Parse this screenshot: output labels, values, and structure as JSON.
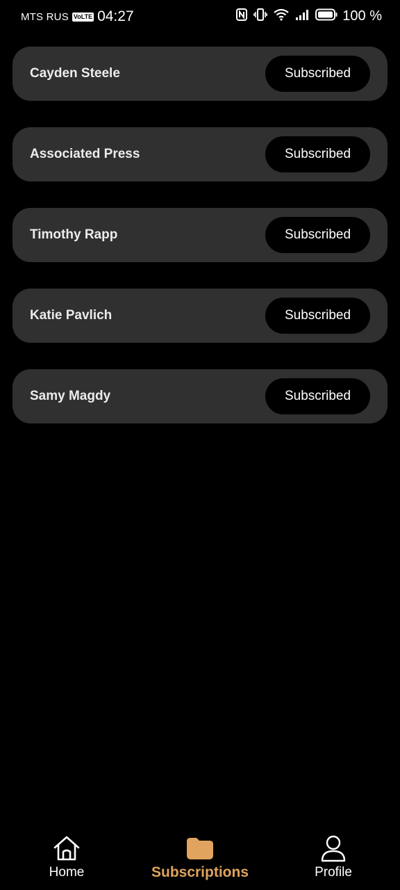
{
  "status_bar": {
    "carrier": "MTS RUS",
    "volte": "VoLTE",
    "time": "04:27",
    "battery_percent": "100 %",
    "icons": [
      "nfc-icon",
      "vibrate-icon",
      "wifi-icon",
      "signal-icon",
      "battery-icon"
    ]
  },
  "subscriptions": [
    {
      "name": "Cayden Steele",
      "button_label": "Subscribed"
    },
    {
      "name": "Associated Press",
      "button_label": "Subscribed"
    },
    {
      "name": "Timothy Rapp",
      "button_label": "Subscribed"
    },
    {
      "name": "Katie Pavlich",
      "button_label": "Subscribed"
    },
    {
      "name": "Samy Magdy",
      "button_label": "Subscribed"
    }
  ],
  "bottom_nav": {
    "items": [
      {
        "label": "Home",
        "icon": "home-icon",
        "active": false
      },
      {
        "label": "Subscriptions",
        "icon": "folder-icon",
        "active": true
      },
      {
        "label": "Profile",
        "icon": "profile-icon",
        "active": false
      }
    ]
  },
  "colors": {
    "background": "#000000",
    "card": "#303030",
    "accent": "#e0a45e",
    "text": "#ffffff"
  }
}
